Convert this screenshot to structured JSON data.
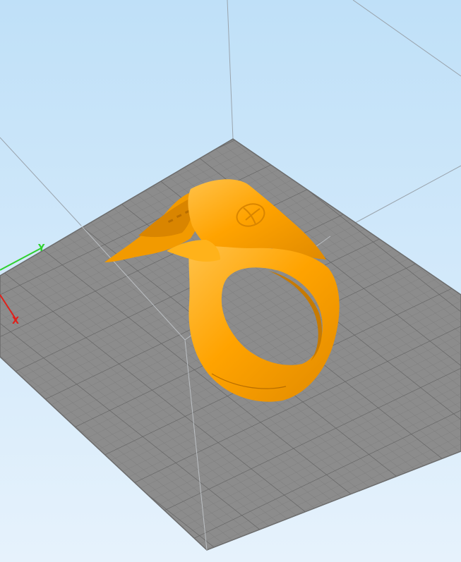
{
  "viewport": {
    "background_top": "#bfe0f8",
    "background_bottom": "#e6f2fc",
    "build_volume_line_color": "#9aa4ad",
    "bed_color": "#8c8c8c",
    "bed_grid_minor_color": "#7a7a7a",
    "bed_grid_major_color": "#5f5f5f"
  },
  "axes": {
    "x_axis": {
      "label": "X",
      "color": "#e0201a"
    },
    "y_axis": {
      "label": "Y",
      "color": "#2fd12f"
    }
  },
  "model": {
    "color": "#ffa300",
    "shade_color": "#e08a00",
    "highlight_color": "#ffc24a",
    "icon": "logo-emboss-icon"
  }
}
